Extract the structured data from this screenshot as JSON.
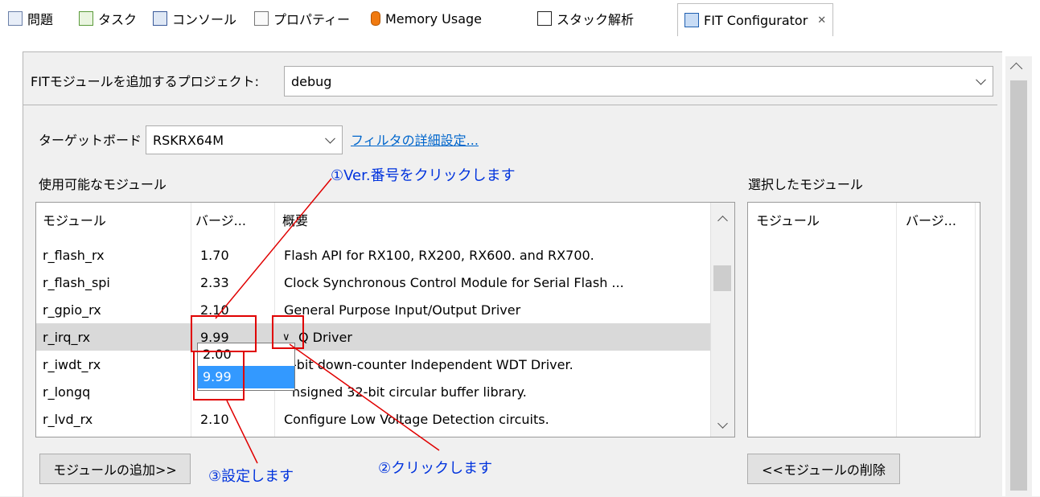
{
  "tabs": [
    {
      "label": "問題",
      "icon": "problems-icon"
    },
    {
      "label": "タスク",
      "icon": "tasks-icon"
    },
    {
      "label": "コンソール",
      "icon": "console-icon"
    },
    {
      "label": "プロパティー",
      "icon": "properties-icon"
    },
    {
      "label": "Memory Usage",
      "icon": "memory-icon"
    },
    {
      "label": "スタック解析",
      "icon": "stack-icon"
    },
    {
      "label": "FIT Configurator",
      "icon": "fit-icon",
      "active": true
    }
  ],
  "project": {
    "label": "FITモジュールを追加するプロジェクト:",
    "value": "debug"
  },
  "board": {
    "label": "ターゲットボード",
    "value": "RSKRX64M",
    "filter_link": "フィルタの詳細設定..."
  },
  "available": {
    "title": "使用可能なモジュール",
    "columns": [
      "モジュール",
      "バージ...",
      "概要"
    ],
    "rows": [
      {
        "module": "r_flash_rx",
        "version": "1.70",
        "summary": "Flash API for RX100, RX200, RX600. and RX700."
      },
      {
        "module": "r_flash_spi",
        "version": "2.33",
        "summary": "Clock Synchronous Control Module for Serial Flash ..."
      },
      {
        "module": "r_gpio_rx",
        "version": "2.10",
        "summary": "General Purpose Input/Output Driver"
      },
      {
        "module": "r_irq_rx",
        "version": "9.99",
        "summary": "Q Driver"
      },
      {
        "module": "r_iwdt_rx",
        "version": "",
        "summary": "-bit down-counter Independent WDT Driver."
      },
      {
        "module": "r_longq",
        "version": "",
        "summary": "nsigned 32-bit circular buffer library."
      },
      {
        "module": "r_lvd_rx",
        "version": "2.10",
        "summary": "Configure Low Voltage Detection circuits."
      }
    ],
    "dropdown_options": [
      "2.00",
      "9.99"
    ],
    "dropdown_selected": "9.99",
    "add_button": "モジュールの追加>>"
  },
  "selected": {
    "title": "選択したモジュール",
    "columns": [
      "モジュール",
      "バージ..."
    ],
    "remove_button": "<<モジュールの削除"
  },
  "annotations": {
    "step1": "①Ver.番号をクリックします",
    "step2": "②クリックします",
    "step3": "③設定します"
  },
  "colors": {
    "annotation": "#0033dd",
    "highlight_box": "#e00000",
    "selection": "#3399ff"
  }
}
